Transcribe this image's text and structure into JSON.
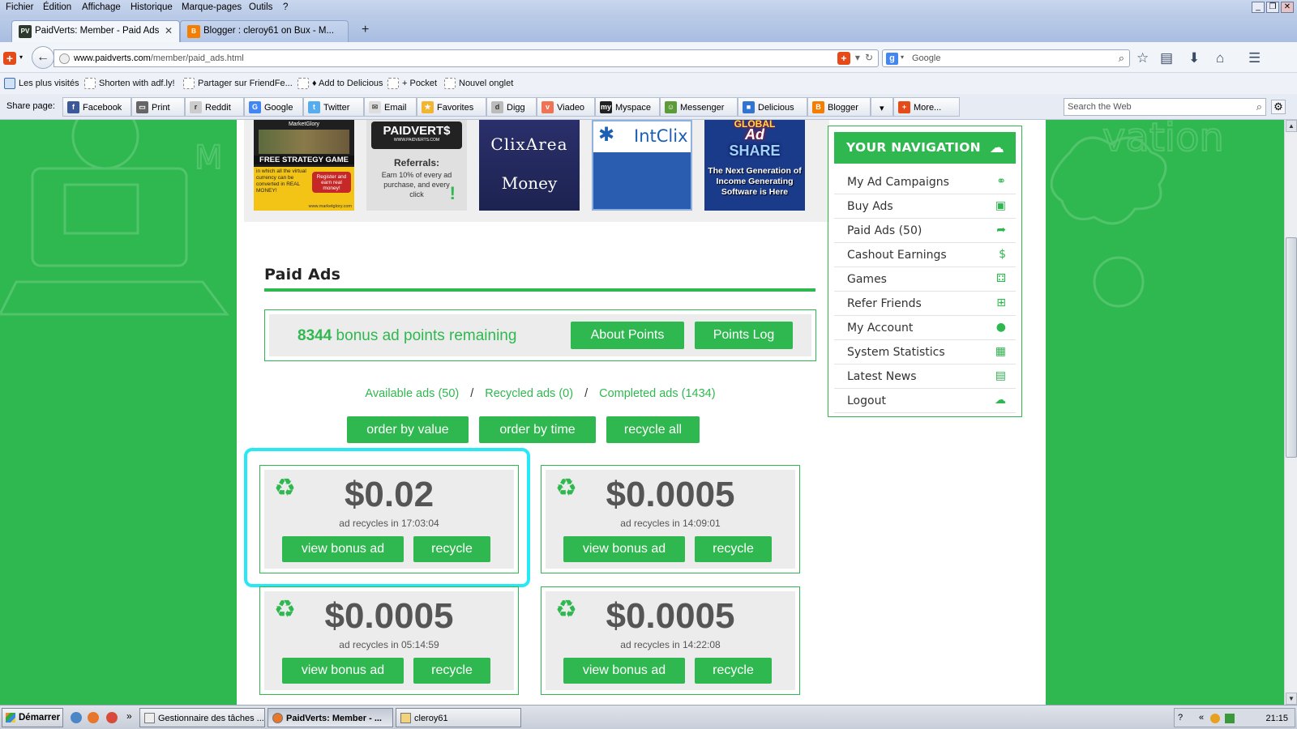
{
  "browser": {
    "menu": [
      "Fichier",
      "Édition",
      "Affichage",
      "Historique",
      "Marque-pages",
      "Outils",
      "?"
    ],
    "tabs": [
      {
        "label": "PaidVerts: Member - Paid Ads",
        "favicon_text": "PV"
      },
      {
        "label": "Blogger : cleroy61 on Bux - M...",
        "favicon_text": "B"
      }
    ],
    "new_tab": "+",
    "url_host": "www.paidverts.com",
    "url_path": "/member/paid_ads.html",
    "search_engine_label": "Google",
    "bookmarks": [
      "Les plus visités",
      "Shorten with adf.ly!",
      "Partager sur FriendFe...",
      "♦ Add to Delicious",
      "+ Pocket",
      "Nouvel onglet"
    ],
    "share_label": "Share page:",
    "share_buttons": [
      "Facebook",
      "Print",
      "Reddit",
      "Google",
      "Twitter",
      "Email",
      "Favorites",
      "Digg",
      "Viadeo",
      "Myspace",
      "Messenger",
      "Delicious",
      "Blogger",
      "",
      "More..."
    ],
    "web_search_placeholder": "Search the Web"
  },
  "banners": {
    "marketglory": {
      "top": "MarketGlory",
      "headline": "FREE STRATEGY GAME",
      "body": "in which all the virtual currency can be converted in REAL MONEY!",
      "badge": "Register and earn real money!",
      "url": "www.marketglory.com"
    },
    "paidverts": {
      "logo": "PAIDVERT$",
      "url": "WWW.PAIDVERTS.COM",
      "line1": "Referrals:",
      "line2": "Earn 10% of every ad purchase, and every click"
    },
    "clixarea": {
      "line1": "ClixArea",
      "line2": "Money"
    },
    "intclix": {
      "logo": "IntClix"
    },
    "globaladshare": {
      "line1": "GLOBAL",
      "line2": "Ad",
      "line3": "SHARE",
      "tagline": "The Next Generation of Income Generating Software is Here"
    }
  },
  "page": {
    "heading": "Paid Ads",
    "points_value": "8344",
    "points_text": " bonus ad points remaining",
    "about_points": "About Points",
    "points_log": "Points Log",
    "filters": {
      "available": "Available ads (50)",
      "recycled": "Recycled ads (0)",
      "completed": "Completed ads (1434)",
      "sep": "/"
    },
    "order_value": "order by value",
    "order_time": "order by time",
    "recycle_all": "recycle all",
    "recycle_prefix": "ad recycles in ",
    "view_label": "view bonus ad",
    "recycle_label": "recycle",
    "ads": [
      {
        "price": "$0.02",
        "time": "17:03:04"
      },
      {
        "price": "$0.0005",
        "time": "14:09:01"
      },
      {
        "price": "$0.0005",
        "time": "05:14:59"
      },
      {
        "price": "$0.0005",
        "time": "14:22:08"
      }
    ]
  },
  "nav": {
    "header": "YOUR NAVIGATION",
    "items": [
      "My Ad Campaigns",
      "Buy Ads",
      "Paid Ads (50)",
      "Cashout Earnings",
      "Games",
      "Refer Friends",
      "My Account",
      "System Statistics",
      "Latest News",
      "Logout"
    ]
  },
  "taskbar": {
    "start": "Démarrer",
    "tasks": [
      "Gestionnaire des tâches ...",
      "PaidVerts: Member - ...",
      "cleroy61"
    ],
    "clock": "21:15"
  },
  "colors": {
    "accent": "#2fb84f",
    "highlight": "#27e8f5"
  }
}
